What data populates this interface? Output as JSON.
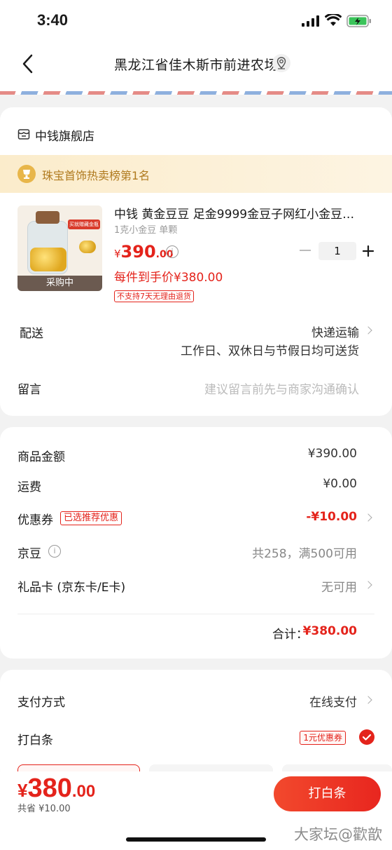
{
  "status_bar": {
    "time": "3:40"
  },
  "header": {
    "title": "黑龙江省佳木斯市前进农场"
  },
  "store": {
    "name": "中钱旗舰店",
    "rank": "珠宝首饰热卖榜第1名",
    "product": {
      "title": "中钱 黄金豆豆 足金9999金豆子网红小金豆…",
      "spec": "1克小金豆 单颗",
      "image_badge": "买就赠藏金瓶",
      "image_overlay": "采购中",
      "price_currency": "¥",
      "price_int": "390",
      "price_dec": ".00",
      "unit_price": "每件到手价¥380.00",
      "no_return_tag": "不支持7天无理由退货",
      "quantity": "1"
    },
    "delivery": {
      "label": "配送",
      "value": "快递运输",
      "sub": "工作日、双休日与节假日均可送货"
    },
    "message": {
      "label": "留言",
      "placeholder": "建议留言前先与商家沟通确认"
    }
  },
  "amounts": {
    "goods": {
      "label": "商品金额",
      "value": "¥390.00"
    },
    "shipping": {
      "label": "运费",
      "value": "¥0.00"
    },
    "coupon": {
      "label": "优惠券",
      "tag": "已选推荐优惠",
      "value": "-¥10.00"
    },
    "beans": {
      "label": "京豆",
      "value": "共258，满500可用"
    },
    "giftcard": {
      "label": "礼品卡 (京东卡/E卡)",
      "value": "无可用"
    },
    "total_label": "合计：",
    "total_value": "¥380.00"
  },
  "payment": {
    "method_label": "支付方式",
    "method_value": "在线支付",
    "baitiao_label": "打白条",
    "baitiao_tag": "1元优惠券"
  },
  "bottom": {
    "currency": "¥",
    "price_int": "380",
    "price_dec": ".00",
    "saved": "共省 ¥10.00",
    "button": "打白条",
    "watermark": "大家坛@歡歆"
  },
  "colors": {
    "accent": "#e4231b",
    "rank_text": "#b07a1e"
  }
}
